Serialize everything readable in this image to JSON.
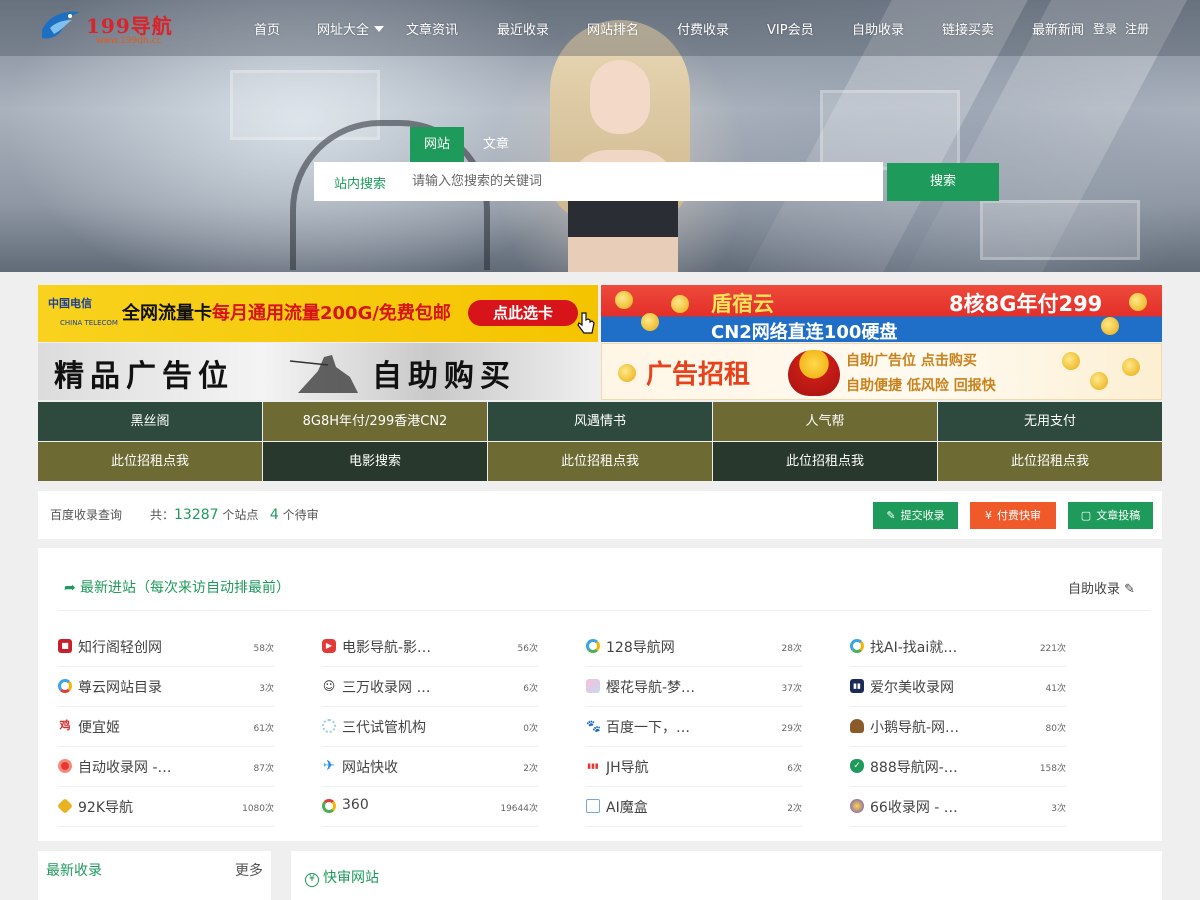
{
  "logo": {
    "text": "199导航",
    "sub": "www.199dh.cc"
  },
  "nav": {
    "items": [
      "首页",
      "网址大全",
      "文章资讯",
      "最近收录",
      "网站排名",
      "付费收录",
      "VIP会员",
      "自助收录",
      "链接买卖",
      "最新新闻"
    ],
    "login": "登录",
    "register": "注册"
  },
  "search": {
    "tabs": [
      "网站",
      "文章"
    ],
    "scope": "站内搜索",
    "placeholder": "请输入您搜索的关键词",
    "button": "搜索"
  },
  "banners": {
    "b1": {
      "brand": "中国电信",
      "brand_en": "CHINA TELECOM",
      "main_a": "全网流量卡",
      "main_b": "每月通用流量200G/免费包邮",
      "cta": "点此选卡"
    },
    "b2": {
      "t1": "盾宿云",
      "t2": "8核8G年付299",
      "t3": "CN2网络直连100硬盘"
    },
    "b3": {
      "t1": "精品广告位",
      "t2": "自助购买"
    },
    "b4": {
      "t1": "广告招租",
      "t2": "自助广告位 点击购买",
      "t3": "自助便捷 低风险 回报快"
    }
  },
  "adgrid": [
    [
      "黑丝阁",
      "8G8H年付/299香港CN2",
      "风遇情书",
      "人气帮",
      "无用支付"
    ],
    [
      "此位招租点我",
      "电影搜索",
      "此位招租点我",
      "此位招租点我",
      "此位招租点我"
    ]
  ],
  "stats": {
    "baidu": "百度收录查询",
    "total_prefix": "共：",
    "site_count": "13287",
    "site_unit": "个站点",
    "pending_count": "4",
    "pending_unit": "个待审",
    "buttons": [
      "提交收录",
      "付费快审",
      "文章投稿"
    ]
  },
  "newsites": {
    "title": "最新进站（每次来访自动排最前）",
    "self": "自助收录",
    "rows": [
      [
        {
          "name": "知行阁轻创网",
          "count": "58次"
        },
        {
          "name": "电影导航-影…",
          "count": "56次"
        },
        {
          "name": "128导航网",
          "count": "28次"
        },
        {
          "name": "找AI-找ai就…",
          "count": "221次"
        }
      ],
      [
        {
          "name": "尊云网站目录",
          "count": "3次"
        },
        {
          "name": "三万收录网 …",
          "count": "6次"
        },
        {
          "name": "樱花导航-梦…",
          "count": "37次"
        },
        {
          "name": "爱尔美收录网",
          "count": "41次"
        }
      ],
      [
        {
          "name": "便宜姬",
          "count": "61次"
        },
        {
          "name": "三代试管机构",
          "count": "0次"
        },
        {
          "name": "百度一下，…",
          "count": "29次"
        },
        {
          "name": "小鹅导航-网…",
          "count": "80次"
        }
      ],
      [
        {
          "name": "自动收录网 -…",
          "count": "87次"
        },
        {
          "name": "网站快收",
          "count": "2次"
        },
        {
          "name": "JH导航",
          "count": "6次"
        },
        {
          "name": "888导航网-…",
          "count": "158次"
        }
      ],
      [
        {
          "name": "92K导航",
          "count": "1080次"
        },
        {
          "name": "360",
          "count": "19644次"
        },
        {
          "name": "AI魔盒",
          "count": "2次"
        },
        {
          "name": "66收录网 - …",
          "count": "3次"
        }
      ]
    ]
  },
  "recent": {
    "title": "最新收录",
    "more": "更多"
  },
  "fast": {
    "title": "快审网站"
  },
  "colors": {
    "accent": "#1e9b5b",
    "orange": "#f0592a",
    "cell_dark": "#2e4a3e",
    "cell_olive": "#6d6a33"
  }
}
